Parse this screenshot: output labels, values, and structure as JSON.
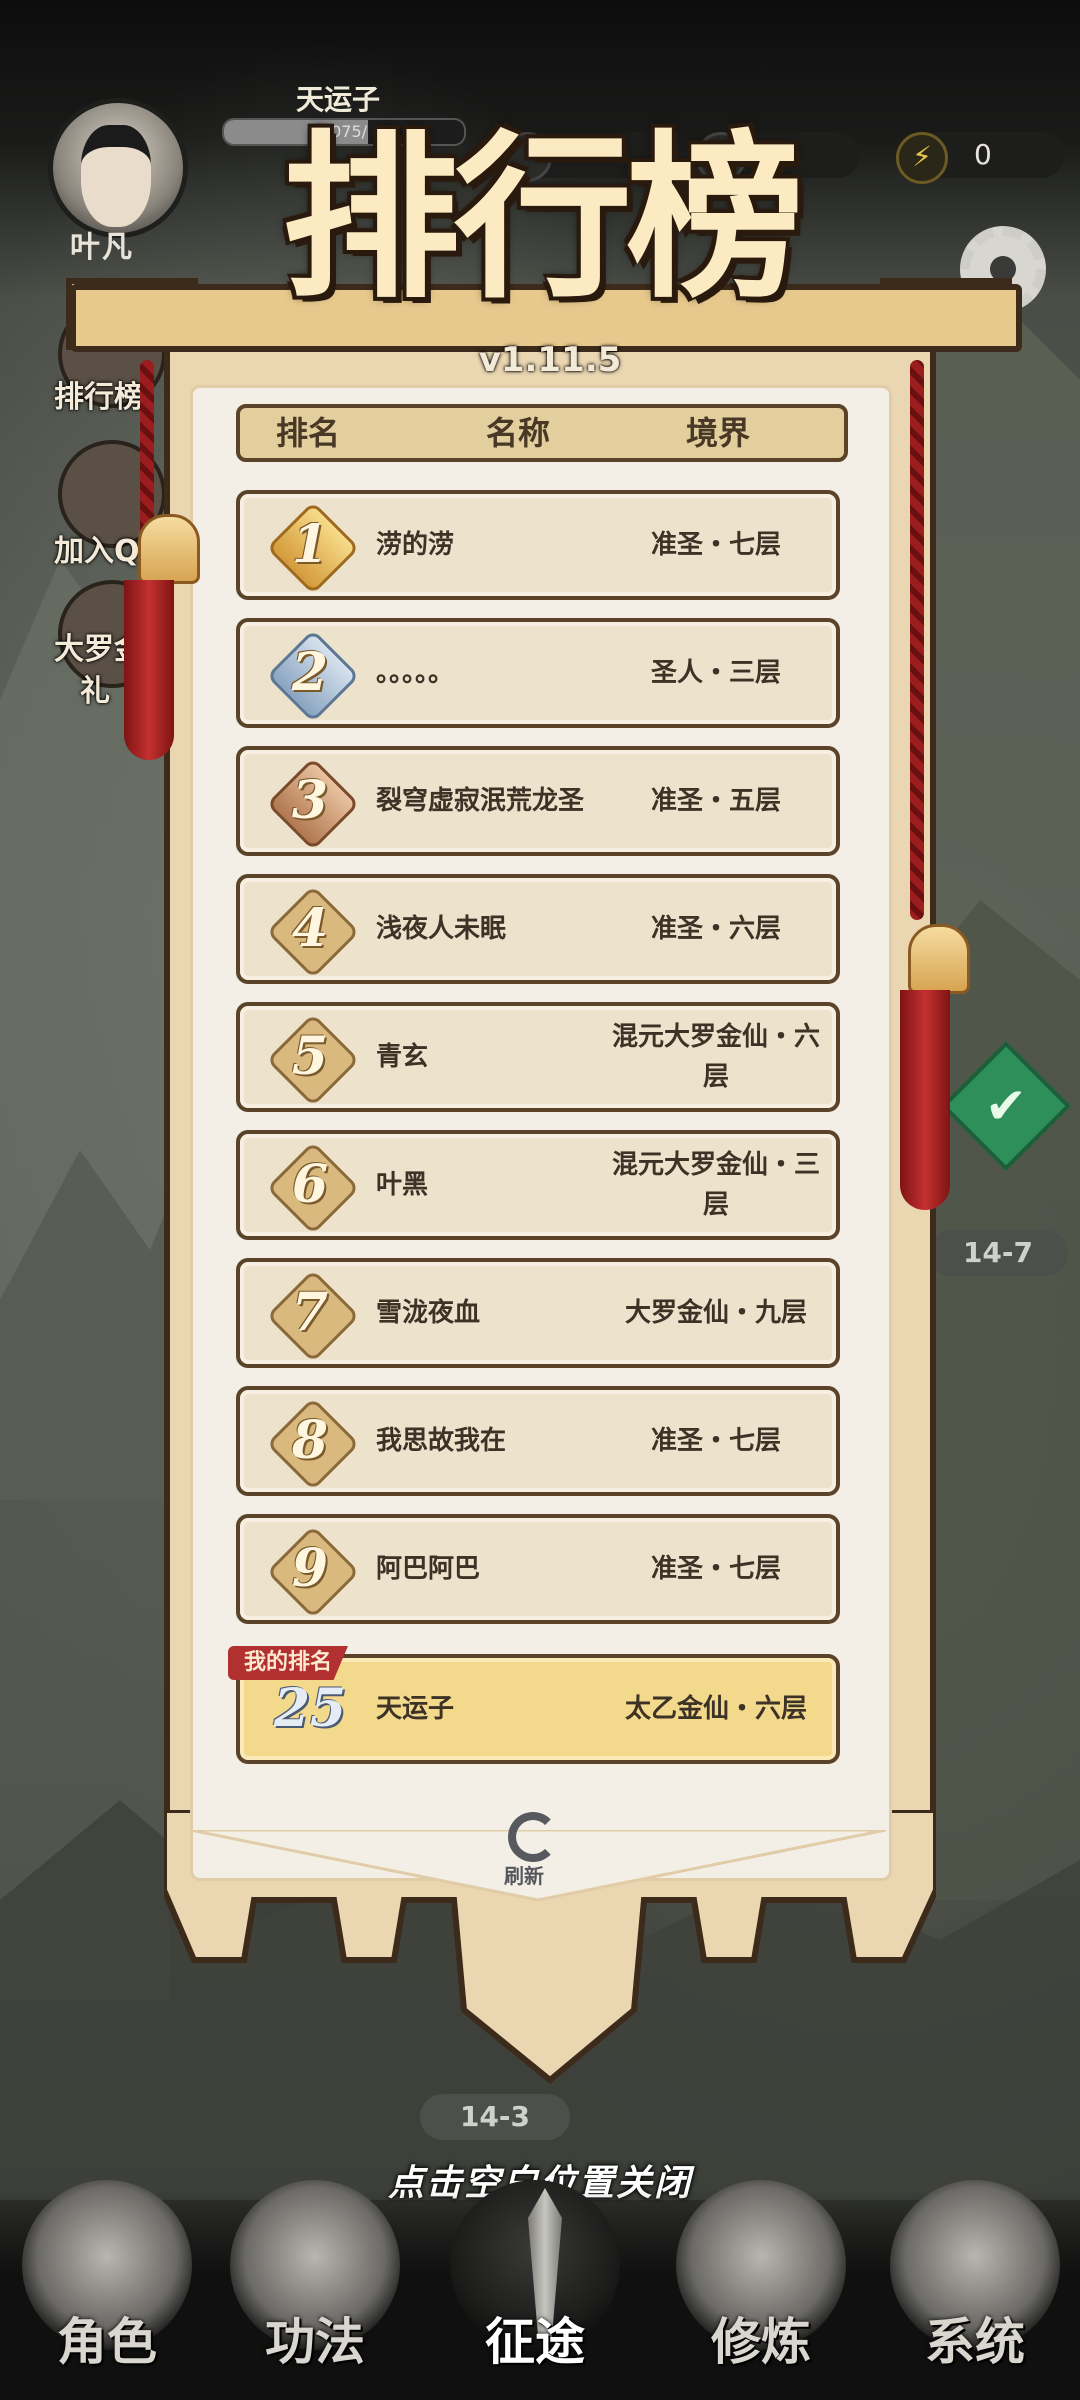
{
  "player": {
    "avatar_name": "叶凡",
    "hud_name": "天运子",
    "exp_text": "5075/",
    "exp_fraction": 0.6
  },
  "resources": {
    "energy": "0"
  },
  "side_menu": [
    {
      "label": "排行榜",
      "icon": "trophy-icon"
    },
    {
      "label": "加入Q",
      "icon": "penguin-icon"
    },
    {
      "label": "大罗金",
      "sub": "礼",
      "icon": "gift-icon"
    }
  ],
  "map": {
    "stage_right": "14-7",
    "stage_bottom": "14-3"
  },
  "leaderboard": {
    "title": "排行榜",
    "version": "v1.11.5",
    "columns": {
      "rank": "排名",
      "name": "名称",
      "realm": "境界"
    },
    "rows": [
      {
        "rank": "1",
        "name": "涝的涝",
        "realm": "准圣・七层"
      },
      {
        "rank": "2",
        "name": "。。。。。",
        "realm": "圣人・三层"
      },
      {
        "rank": "3",
        "name": "裂穹虚寂泯荒龙圣",
        "realm": "准圣・五层"
      },
      {
        "rank": "4",
        "name": "浅夜人未眠",
        "realm": "准圣・六层"
      },
      {
        "rank": "5",
        "name": "青玄",
        "realm": "混元大罗金仙・六层"
      },
      {
        "rank": "6",
        "name": "叶黑",
        "realm": "混元大罗金仙・三层"
      },
      {
        "rank": "7",
        "name": "雪泷夜血",
        "realm": "大罗金仙・九层"
      },
      {
        "rank": "8",
        "name": "我思故我在",
        "realm": "准圣・七层"
      },
      {
        "rank": "9",
        "name": "阿巴阿巴",
        "realm": "准圣・七层"
      }
    ],
    "my_rank": {
      "tag": "我的排名",
      "rank": "25",
      "name": "天运子",
      "realm": "太乙金仙・六层"
    },
    "refresh_label": "刷新"
  },
  "close_hint": "点击空白位置关闭",
  "bottom_nav": [
    {
      "label": "角色",
      "active": false
    },
    {
      "label": "功法",
      "active": false
    },
    {
      "label": "征途",
      "active": true
    },
    {
      "label": "修炼",
      "active": false
    },
    {
      "label": "系统",
      "active": false
    }
  ],
  "colors": {
    "banner": "#ead6b0",
    "row": "#ede2cc",
    "my_row": "#f2d98c",
    "tag_red": "#b2302f",
    "tassel": "#9b1d1d"
  }
}
